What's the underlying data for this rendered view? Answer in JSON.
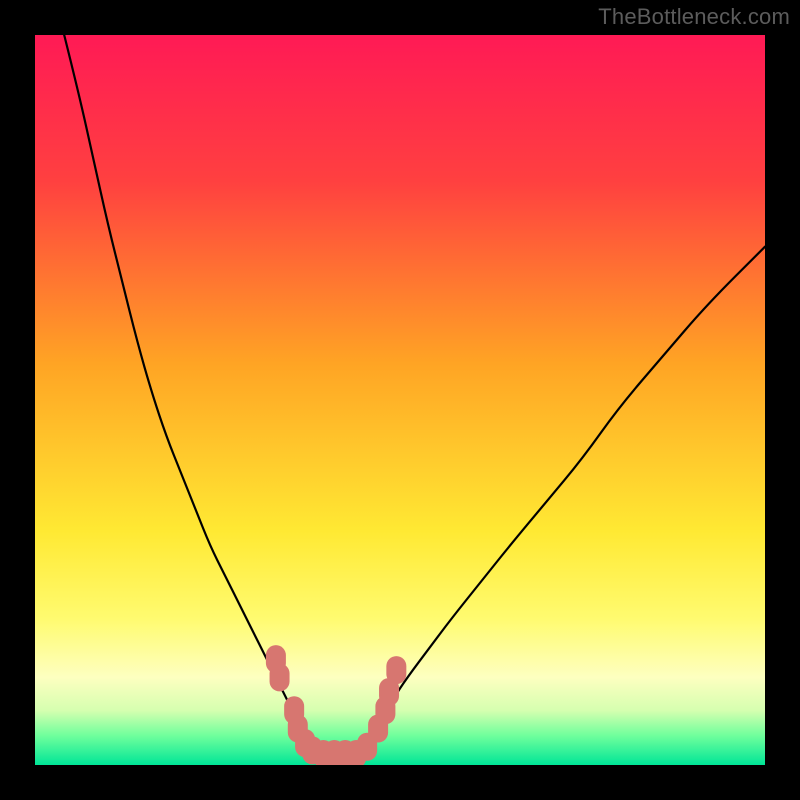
{
  "watermark": "TheBottleneck.com",
  "chart_data": {
    "type": "line",
    "title": "",
    "xlabel": "",
    "ylabel": "",
    "xlim": [
      0,
      100
    ],
    "ylim": [
      0,
      100
    ],
    "grid": false,
    "background_gradient": {
      "type": "vertical",
      "stops": [
        {
          "offset": 0.0,
          "color": "#ff1a55"
        },
        {
          "offset": 0.2,
          "color": "#ff4040"
        },
        {
          "offset": 0.45,
          "color": "#ffa424"
        },
        {
          "offset": 0.68,
          "color": "#ffe933"
        },
        {
          "offset": 0.8,
          "color": "#fffb70"
        },
        {
          "offset": 0.88,
          "color": "#fdffc0"
        },
        {
          "offset": 0.925,
          "color": "#d6ffb0"
        },
        {
          "offset": 0.96,
          "color": "#6fff9c"
        },
        {
          "offset": 1.0,
          "color": "#00e597"
        }
      ]
    },
    "series": [
      {
        "name": "left-curve",
        "stroke": "#000000",
        "stroke_width": 2.2,
        "x": [
          4,
          6,
          8,
          10,
          12,
          14,
          16,
          18,
          20,
          22,
          24,
          26,
          28,
          30,
          31.5,
          33,
          34.5,
          36,
          37
        ],
        "y": [
          100,
          92,
          83,
          74,
          66,
          58,
          51,
          45,
          40,
          35,
          30,
          26,
          22,
          18,
          15,
          12,
          9,
          6,
          3
        ]
      },
      {
        "name": "right-curve",
        "stroke": "#000000",
        "stroke_width": 2.2,
        "x": [
          46,
          47.5,
          49,
          51,
          54,
          57,
          61,
          65,
          70,
          75,
          80,
          86,
          92,
          100
        ],
        "y": [
          3,
          6,
          9,
          12,
          16,
          20,
          25,
          30,
          36,
          42,
          49,
          56,
          63,
          71
        ]
      }
    ],
    "markers": [
      {
        "name": "bottom-markers",
        "color": "#d77670",
        "points": [
          {
            "x": 33.0,
            "y": 14.5
          },
          {
            "x": 33.5,
            "y": 12.0
          },
          {
            "x": 35.5,
            "y": 7.5
          },
          {
            "x": 36.0,
            "y": 5.0
          },
          {
            "x": 37.0,
            "y": 3.0
          },
          {
            "x": 38.0,
            "y": 2.0
          },
          {
            "x": 39.5,
            "y": 1.5
          },
          {
            "x": 41.0,
            "y": 1.5
          },
          {
            "x": 42.5,
            "y": 1.5
          },
          {
            "x": 44.0,
            "y": 1.5
          },
          {
            "x": 45.5,
            "y": 2.5
          },
          {
            "x": 47.0,
            "y": 5.0
          },
          {
            "x": 48.0,
            "y": 7.5
          },
          {
            "x": 48.5,
            "y": 10.0
          },
          {
            "x": 49.5,
            "y": 13.0
          }
        ]
      }
    ]
  }
}
